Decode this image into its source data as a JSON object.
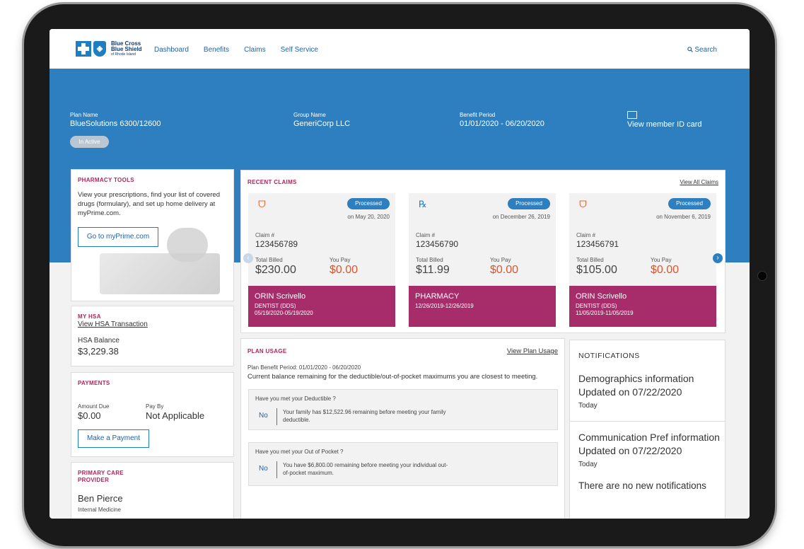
{
  "logo": {
    "line1": "Blue Cross",
    "line2": "Blue Shield",
    "line3": "of Rhode Island",
    "shield_glyph": "◈"
  },
  "nav": {
    "items": [
      "Dashboard",
      "Benefits",
      "Claims",
      "Self Service"
    ],
    "search": "Search",
    "search_icon": "search-icon"
  },
  "plan": {
    "plan_name_label": "Plan Name",
    "plan_name": "BlueSolutions 6300/12600",
    "group_label": "Group Name",
    "group": "GeneriCorp LLC",
    "period_label": "Benefit Period",
    "period": "01/01/2020 - 06/20/2020",
    "status": "In Active",
    "id_card": "View member ID card"
  },
  "pharmacy": {
    "title": "PHARMACY TOOLS",
    "text": "View your prescriptions, find your list of covered drugs (formulary), and set up home delivery at myPrime.com.",
    "button": "Go to myPrime.com"
  },
  "hsa": {
    "title": "MY HSA",
    "link": "View HSA Transaction",
    "balance_label": "HSA Balance",
    "balance": "$3,229.38"
  },
  "payments": {
    "title": "PAYMENTS",
    "amount_label": "Amount Due",
    "amount": "$0.00",
    "payby_label": "Pay By",
    "payby": "Not Applicable",
    "button": "Make a Payment"
  },
  "pcp": {
    "title_line1": "PRIMARY CARE",
    "title_line2": "PROVIDER",
    "name": "Ben Pierce",
    "specialty": "Internal Medicine"
  },
  "claims": {
    "title": "RECENT CLAIMS",
    "view_all": "View All Claims",
    "items": [
      {
        "status": "Processed",
        "date": "on May 20, 2020",
        "claim_label": "Claim #",
        "claim_no": "123456789",
        "billed_label": "Total Billed",
        "billed": "$230.00",
        "pay_label": "You Pay",
        "pay": "$0.00",
        "provider": "ORIN Scrivello",
        "specialty": "DENTIST (DDS)",
        "dates": "05/19/2020-05/19/2020",
        "icon": "tooth-icon",
        "glyph": "ᗜ"
      },
      {
        "status": "Processed",
        "date": "on December 26, 2019",
        "claim_label": "Claim #",
        "claim_no": "123456790",
        "billed_label": "Total Billed",
        "billed": "$11.99",
        "pay_label": "You Pay",
        "pay": "$0.00",
        "provider": "PHARMACY",
        "specialty": "",
        "dates": "12/26/2019-12/26/2019",
        "icon": "pill-icon",
        "glyph": "℞"
      },
      {
        "status": "Processed",
        "date": "on November 6, 2019",
        "claim_label": "Claim #",
        "claim_no": "123456791",
        "billed_label": "Total Billed",
        "billed": "$105.00",
        "pay_label": "You Pay",
        "pay": "$0.00",
        "provider": "ORIN Scrivello",
        "specialty": "DENTIST (DDS)",
        "dates": "11/05/2019-11/05/2019",
        "icon": "tooth-icon",
        "glyph": "ᗜ"
      }
    ]
  },
  "usage": {
    "title": "PLAN USAGE",
    "link": "View Plan Usage",
    "period": "Plan Benefit Period: 01/01/2020 - 06/20/2020",
    "desc": "Current balance remaining for the deductible/out-of-pocket maximums you are closest to meeting.",
    "q1": "Have you met your Deductible ?",
    "a1_no": "No",
    "a1": "Your family has $12,522.96 remaining before meeting your family deductible.",
    "q2": "Have you met your Out of Pocket ?",
    "a2_no": "No",
    "a2": "You have $6,800.00 remaining before meeting your individual out-of-pocket maximum."
  },
  "notifications": {
    "title": "NOTIFICATIONS",
    "n1_title": "Demographics information Updated on 07/22/2020",
    "n1_when": "Today",
    "n2_title": "Communication Pref information Updated on 07/22/2020",
    "n2_when": "Today",
    "empty": "There are no new notifications"
  },
  "colors": {
    "brand_blue": "#2d7fc0",
    "claim_magenta": "#a62c6a",
    "you_pay_orange": "#e0542a",
    "section_title": "#b0255e"
  }
}
